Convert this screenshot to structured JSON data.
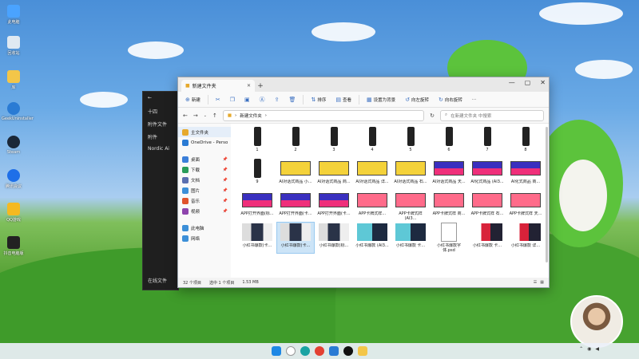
{
  "desktop": {
    "icons": [
      "此电脑",
      "回收站",
      "库",
      "GeekUninstaller",
      "Steam",
      "腾讯会议",
      "QQ游戏",
      "抖音电脑版"
    ]
  },
  "background_window": {
    "items": [
      "十四",
      "附件文件",
      "附件",
      "Nordic Ai"
    ],
    "footer": "在线文件"
  },
  "explorer": {
    "tab_title": "新建文件夹",
    "toolbar": {
      "new": "新建",
      "sort": "排序",
      "view": "查看",
      "set_wallpaper": "设置为背景",
      "rotate_left": "向左旋转",
      "rotate_right": "向右旋转",
      "more": "···"
    },
    "address": {
      "path": "新建文件夹",
      "search_placeholder": "在新建文件夹 中搜索"
    },
    "sidebar": {
      "items": [
        {
          "label": "主文件夹",
          "color": "#e6a92c",
          "pin": ""
        },
        {
          "label": "OneDrive - Perso",
          "color": "#2a7bd4",
          "pin": ""
        },
        {
          "label": "桌面",
          "color": "#3b7fd9",
          "pin": "📌"
        },
        {
          "label": "下载",
          "color": "#2a9c5a",
          "pin": "📌"
        },
        {
          "label": "文档",
          "color": "#5a6fb0",
          "pin": "📌"
        },
        {
          "label": "图片",
          "color": "#3c8fd8",
          "pin": "📌"
        },
        {
          "label": "音乐",
          "color": "#e0532b",
          "pin": "📌"
        },
        {
          "label": "视频",
          "color": "#8e44ad",
          "pin": "📌"
        },
        {
          "label": "此电脑",
          "color": "#3c8fd8",
          "pin": ""
        },
        {
          "label": "网络",
          "color": "#3c8fd8",
          "pin": ""
        }
      ]
    },
    "files": [
      {
        "label": "1",
        "kind": "phone"
      },
      {
        "label": "2",
        "kind": "phone"
      },
      {
        "label": "3",
        "kind": "phone"
      },
      {
        "label": "4",
        "kind": "phone"
      },
      {
        "label": "5",
        "kind": "phone"
      },
      {
        "label": "6",
        "kind": "phone"
      },
      {
        "label": "7",
        "kind": "phone"
      },
      {
        "label": "8",
        "kind": "phone"
      },
      {
        "label": "9",
        "kind": "phone"
      },
      {
        "label": "AI对话式商品 小...",
        "kind": "yellow"
      },
      {
        "label": "AI对话式商品 商...",
        "kind": "yellow"
      },
      {
        "label": "AI对话式商品 详...",
        "kind": "yellow"
      },
      {
        "label": "AI对话式商品 石...",
        "kind": "yellow"
      },
      {
        "label": "AI对话式商品 天...",
        "kind": "purple"
      },
      {
        "label": "AI化式商品 (AI3...",
        "kind": "purple"
      },
      {
        "label": "AI化式商品 商...",
        "kind": "purple"
      },
      {
        "label": "APP打开界面(标...",
        "kind": "purple"
      },
      {
        "label": "APP打开界面(卡...",
        "kind": "purple"
      },
      {
        "label": "APP打开界面(卡...",
        "kind": "purple"
      },
      {
        "label": "APP卡牌式样...",
        "kind": "pink"
      },
      {
        "label": "APP卡牌式样 (AI3...",
        "kind": "pink"
      },
      {
        "label": "APP卡牌式样 商...",
        "kind": "pink"
      },
      {
        "label": "APP卡牌式样 石...",
        "kind": "pink"
      },
      {
        "label": "APP卡牌式样 天...",
        "kind": "pink"
      },
      {
        "label": "小红书爆款(卡...",
        "kind": "photo"
      },
      {
        "label": "小红书爆款(卡...",
        "kind": "photo"
      },
      {
        "label": "小红书爆款(标...",
        "kind": "photo"
      },
      {
        "label": "小红书爆款 (AI3...",
        "kind": "teal"
      },
      {
        "label": "小红书爆款 卡...",
        "kind": "teal"
      },
      {
        "label": "小红书爆款字体.psd",
        "kind": "file"
      },
      {
        "label": "小红书爆款 卡...",
        "kind": "red"
      },
      {
        "label": "小红书爆款 详...",
        "kind": "red"
      }
    ],
    "selected_index": 25,
    "status": {
      "count": "32 个项目",
      "selected": "选中 1 个项目",
      "size": "1.53 MB"
    }
  }
}
